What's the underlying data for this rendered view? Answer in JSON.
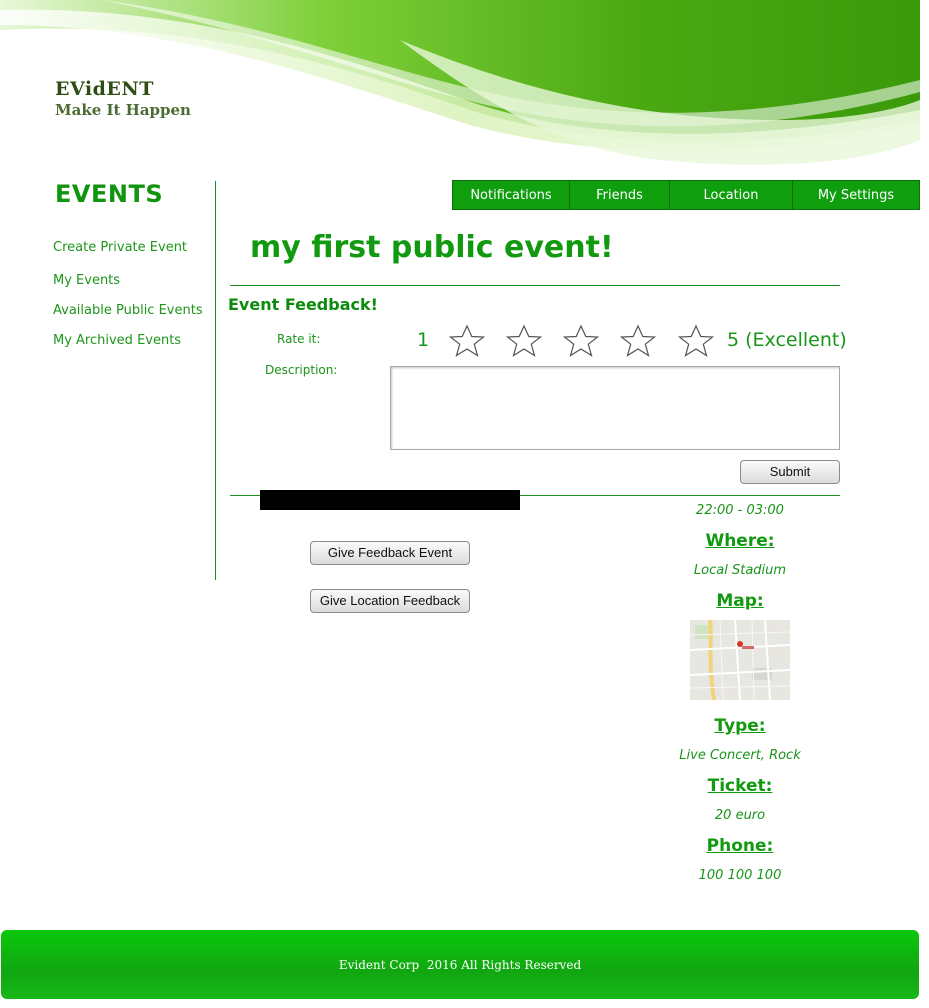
{
  "brand": {
    "title": "EVidENT",
    "tagline": "Make It Happen"
  },
  "sidebar": {
    "title": "EVENTS",
    "items": [
      {
        "label": "Create Private Event"
      },
      {
        "label": "My Events"
      },
      {
        "label": "Available Public Events"
      },
      {
        "label": "My Archived Events"
      }
    ]
  },
  "nav": {
    "items": [
      {
        "label": "Notifications"
      },
      {
        "label": "Friends"
      },
      {
        "label": "Location"
      },
      {
        "label": "My Settings"
      }
    ]
  },
  "event": {
    "title": "my first public event!"
  },
  "feedback": {
    "heading": "Event Feedback!",
    "rate_label": "Rate it:",
    "rate_min": "1",
    "rate_max": "5 (Excellent)",
    "star_icon": "star-outline-icon",
    "description_label": "Description:",
    "description_value": "",
    "submit_label": "Submit"
  },
  "actions": {
    "give_feedback_label": "Give Feedback Event",
    "give_location_feedback_label": "Give Location Feedback"
  },
  "details": {
    "time": "22:00 - 03:00",
    "where_heading": "Where:",
    "where_value": "Local Stadium",
    "map_heading": "Map:",
    "type_heading": "Type:",
    "type_value": "Live Concert, Rock",
    "ticket_heading": "Ticket:",
    "ticket_value": "20 euro",
    "phone_heading": "Phone:",
    "phone_value": "100 100 100"
  },
  "footer": {
    "text": "Evident Corp  2016 All Rights Reserved"
  },
  "colors": {
    "accent": "#119a0f",
    "nav_bg": "#0e9e0e",
    "footer_bg": "#11a611"
  }
}
